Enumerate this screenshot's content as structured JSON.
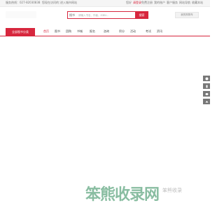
{
  "topbar": {
    "phone": "服务热线：027-82030838",
    "location": "您现在访问的：",
    "entry": "进入城市网站",
    "login": "您好",
    "register": "请登录",
    "register2": "免费注册",
    "links": [
      "我的账户",
      "客户服务",
      "网站导航",
      "收藏本站"
    ]
  },
  "search": {
    "type": "搜书",
    "placeholder": "请输入书名、作者、ISBN...",
    "button": "搜索"
  },
  "cart": {
    "label": "我的购物车"
  },
  "nav": {
    "category": "全部图书分类",
    "items": [
      "首页",
      "图书",
      "团购",
      "书城",
      "报名",
      "咨询",
      "积分",
      "活动",
      "考试",
      "资讯"
    ],
    "active_index": 0
  },
  "side_tools": [
    "qq-icon",
    "phone-icon",
    "wechat-icon",
    "top-icon"
  ],
  "watermark": {
    "main": "笨熊收录网",
    "sub": "笨熊收录"
  },
  "colors": {
    "accent": "#d7263d",
    "watermark": "#7fb89a"
  }
}
